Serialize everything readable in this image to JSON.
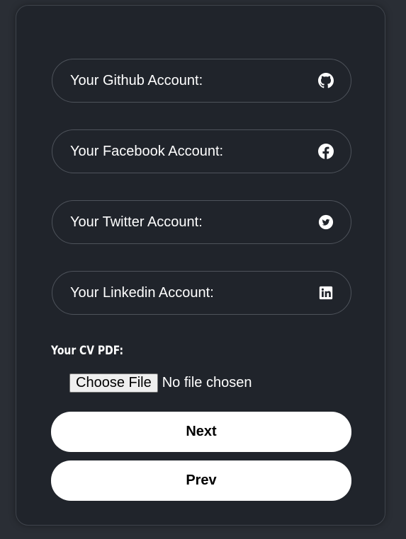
{
  "social": {
    "github": {
      "label": "Your Github Account:",
      "icon": "github-icon"
    },
    "facebook": {
      "label": "Your Facebook Account:",
      "icon": "facebook-icon"
    },
    "twitter": {
      "label": "Your Twitter Account:",
      "icon": "twitter-icon"
    },
    "linkedin": {
      "label": "Your Linkedin Account:",
      "icon": "linkedin-icon"
    }
  },
  "cv": {
    "label": "Your CV PDF:",
    "button_label": "Choose File",
    "status": "No file chosen"
  },
  "actions": {
    "next_label": "Next",
    "prev_label": "Prev"
  },
  "colors": {
    "page_bg": "#2a2e35",
    "card_bg": "#20242b",
    "field_border": "#4e535b",
    "text": "#ffffff",
    "button_bg": "#ffffff"
  }
}
